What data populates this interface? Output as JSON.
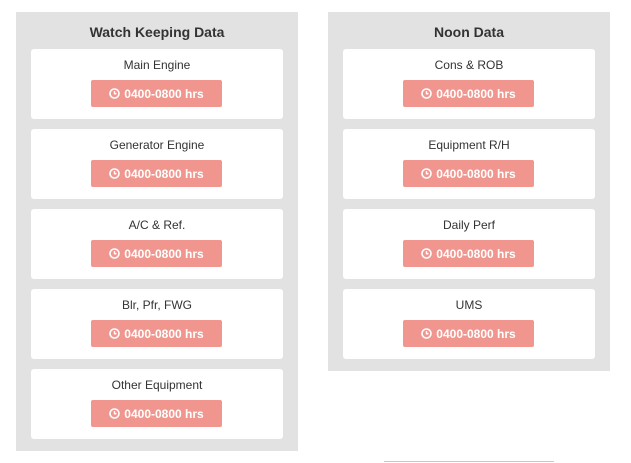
{
  "watch_keeping": {
    "title": "Watch Keeping Data",
    "items": [
      {
        "label": "Main Engine",
        "time": "0400-0800 hrs"
      },
      {
        "label": "Generator Engine",
        "time": "0400-0800 hrs"
      },
      {
        "label": "A/C & Ref.",
        "time": "0400-0800 hrs"
      },
      {
        "label": "Blr, Pfr, FWG",
        "time": "0400-0800 hrs"
      },
      {
        "label": "Other Equipment",
        "time": "0400-0800 hrs"
      }
    ]
  },
  "noon": {
    "title": "Noon Data",
    "items": [
      {
        "label": "Cons & ROB",
        "time": "0400-0800 hrs"
      },
      {
        "label": "Equipment R/H",
        "time": "0400-0800 hrs"
      },
      {
        "label": "Daily Perf",
        "time": "0400-0800 hrs"
      },
      {
        "label": "UMS",
        "time": "0400-0800 hrs"
      }
    ]
  },
  "colors": {
    "panel_bg": "#e2e2e2",
    "button_bg": "#f0968e",
    "button_text": "#ffffff"
  },
  "icons": {
    "time_button": "clock-icon"
  }
}
